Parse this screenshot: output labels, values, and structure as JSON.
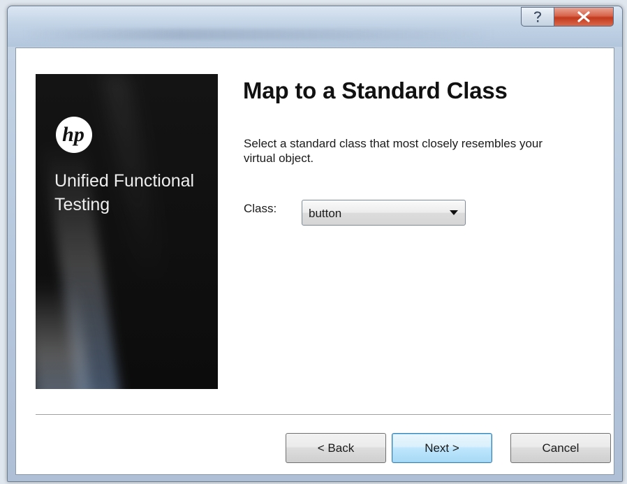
{
  "window": {
    "title_blurred": true,
    "help_button_glyph": "?",
    "close_button_glyph": "x"
  },
  "banner": {
    "logo_text": "hp",
    "product_name": "Unified Functional Testing"
  },
  "page": {
    "title": "Map to a Standard Class",
    "description": "Select a standard class that most closely resembles your virtual object."
  },
  "class_field": {
    "label": "Class:",
    "selected_value": "button"
  },
  "buttons": {
    "back_label": "< Back",
    "next_label": "Next >",
    "cancel_label": "Cancel"
  },
  "colors": {
    "close_button": "#c9462a",
    "focus_button_border": "#3c7fb1",
    "banner_bg": "#111111"
  },
  "icons": {
    "help": "help-icon",
    "close": "close-icon",
    "dropdown": "chevron-down-icon",
    "logo": "hp-logo-icon"
  }
}
